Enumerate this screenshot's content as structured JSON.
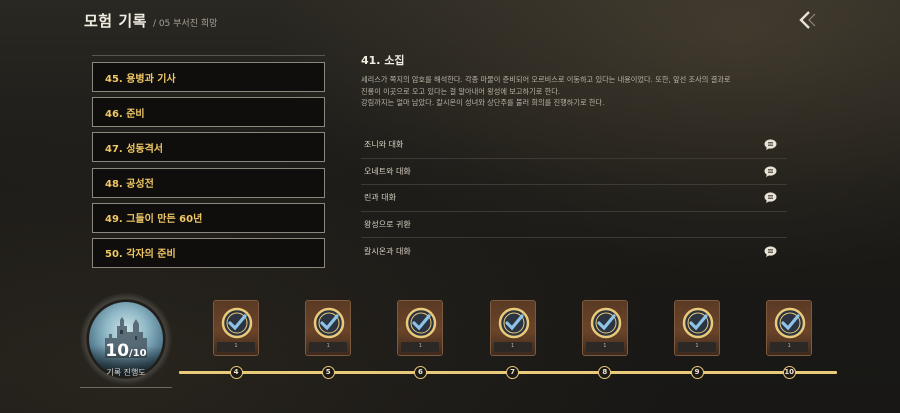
{
  "header": {
    "title": "모험 기록",
    "breadcrumb": "/ 05 부서진 희망"
  },
  "chapters": [
    {
      "label": "45. 용병과 기사"
    },
    {
      "label": "46. 준비"
    },
    {
      "label": "47. 성동격서"
    },
    {
      "label": "48. 공성전"
    },
    {
      "label": "49. 그들이 만든 60년"
    },
    {
      "label": "50. 각자의 준비"
    }
  ],
  "detail": {
    "title": "41. 소집",
    "description_lines": [
      "세리스가 쪽지의 암호를 해석한다. 각종 마물이 준비되어 오르비스로 이동하고 있다는 내용이었다. 또한, 앞선 조사의 결과로",
      "진룡이 이곳으로 오고 있다는 걸 알아내어 왕성에 보고하기로 한다.",
      "강림까지는 얼마 남았다. 칼시온이 성녀와 상단주를 불러 회의를 진행하기로 한다."
    ]
  },
  "quests": [
    {
      "label": "조니와 대화",
      "has_icon": true,
      "icon": "chat-bubble-icon"
    },
    {
      "label": "오네트와 대화",
      "has_icon": true,
      "icon": "chat-bubble-icon"
    },
    {
      "label": "린과 대화",
      "has_icon": true,
      "icon": "chat-bubble-icon"
    },
    {
      "label": "왕성으로 귀환",
      "has_icon": false
    },
    {
      "label": "칼시온과 대화",
      "has_icon": true,
      "icon": "chat-bubble-icon"
    }
  ],
  "progress": {
    "current": "10",
    "total": "/10",
    "label": "기록 진행도",
    "fraction": 1.0
  },
  "timeline": {
    "nodes": [
      {
        "label": "4",
        "card_caption": "1"
      },
      {
        "label": "5",
        "card_caption": "1"
      },
      {
        "label": "6",
        "card_caption": "1"
      },
      {
        "label": "7",
        "card_caption": "1"
      },
      {
        "label": "8",
        "card_caption": "1"
      },
      {
        "label": "9",
        "card_caption": "1"
      },
      {
        "label": "10",
        "card_caption": "1"
      }
    ]
  },
  "colors": {
    "accent": "#f0c766",
    "timeline": "#e9c97a",
    "card": "#6a4429"
  }
}
